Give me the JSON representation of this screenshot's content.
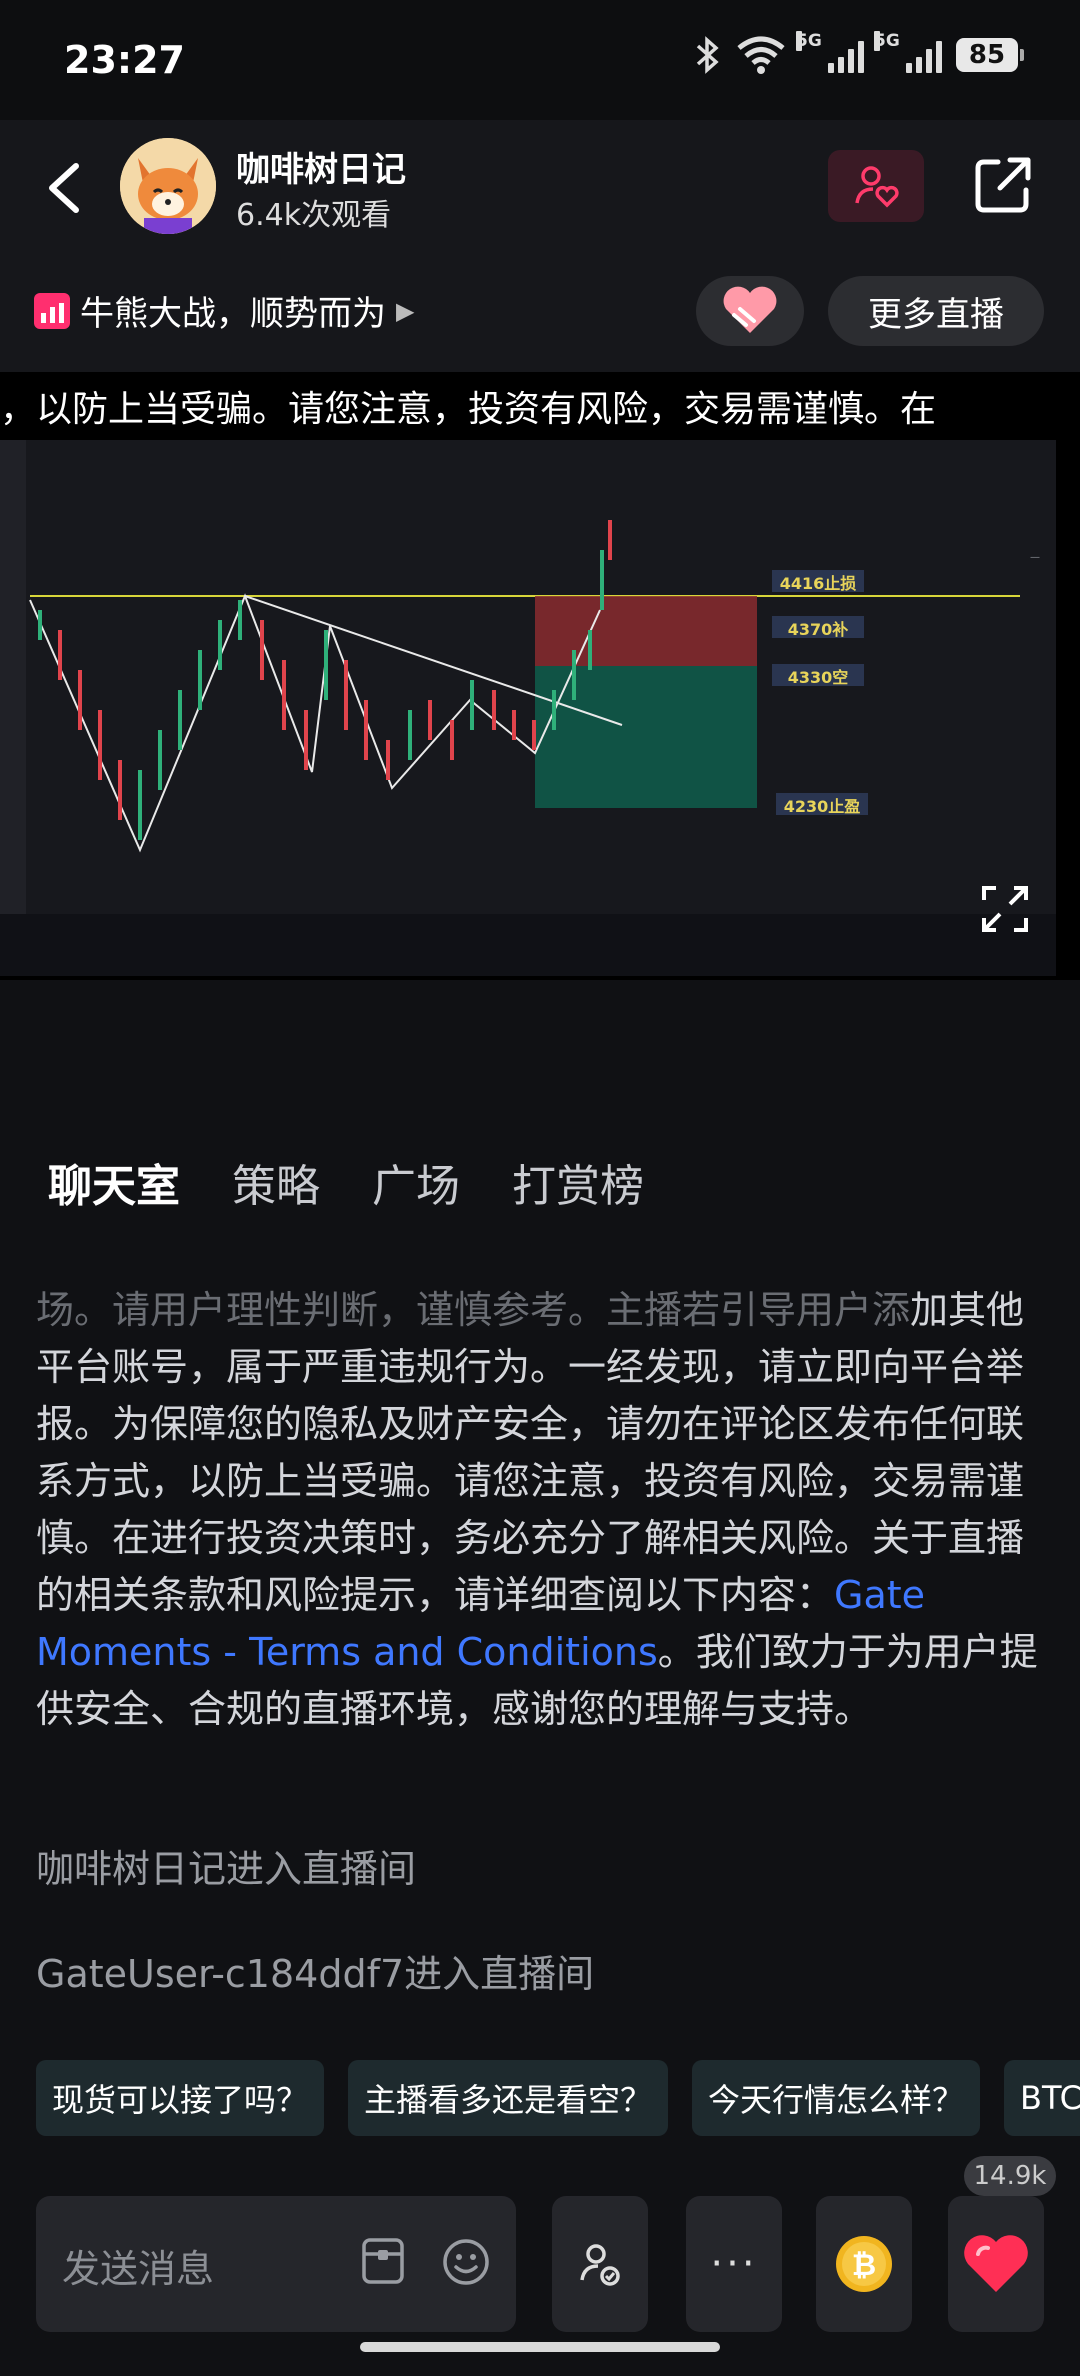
{
  "status_bar": {
    "time": "23:27",
    "signal1_label": "5G",
    "signal2_label": "5G",
    "battery": "85"
  },
  "header": {
    "host_name": "咖啡树日记",
    "views": "6.4k次观看",
    "topic": "牛熊大战，顺势而为",
    "more_live": "更多直播"
  },
  "video": {
    "marquee": "，以防上当受骗。请您注意，投资有风险，交易需谨慎。在",
    "levels": [
      "4416止损",
      "4370补",
      "4330空",
      "4230止盈"
    ]
  },
  "tabs": [
    "聊天室",
    "策略",
    "广场",
    "打赏榜"
  ],
  "chat": {
    "notice_faded": "场。请用户理性判断，谨慎参考。主播若引导用户添",
    "notice_main": "加其他平台账号，属于严重违规行为。一经发现，请立即向平台举报。为保障您的隐私及财产安全，请勿在评论区发布任何联系方式，以防上当受骗。请您注意，投资有风险，交易需谨慎。在进行投资决策时，务必充分了解相关风险。关于直播的相关条款和风险提示，请详细查阅以下内容：",
    "notice_link": "Gate Moments - Terms and Conditions",
    "notice_end": "。我们致力于为用户提供安全、合规的直播环境，感谢您的理解与支持。",
    "join1": "咖啡树日记进入直播间",
    "join2": "GateUser-c184ddf7进入直播间"
  },
  "quick_questions": [
    "现货可以接了吗？",
    "主播看多还是看空？",
    "今天行情怎么样？",
    "BTC"
  ],
  "bottom": {
    "input_placeholder": "发送消息",
    "more": "···",
    "like_count": "14.9k"
  }
}
